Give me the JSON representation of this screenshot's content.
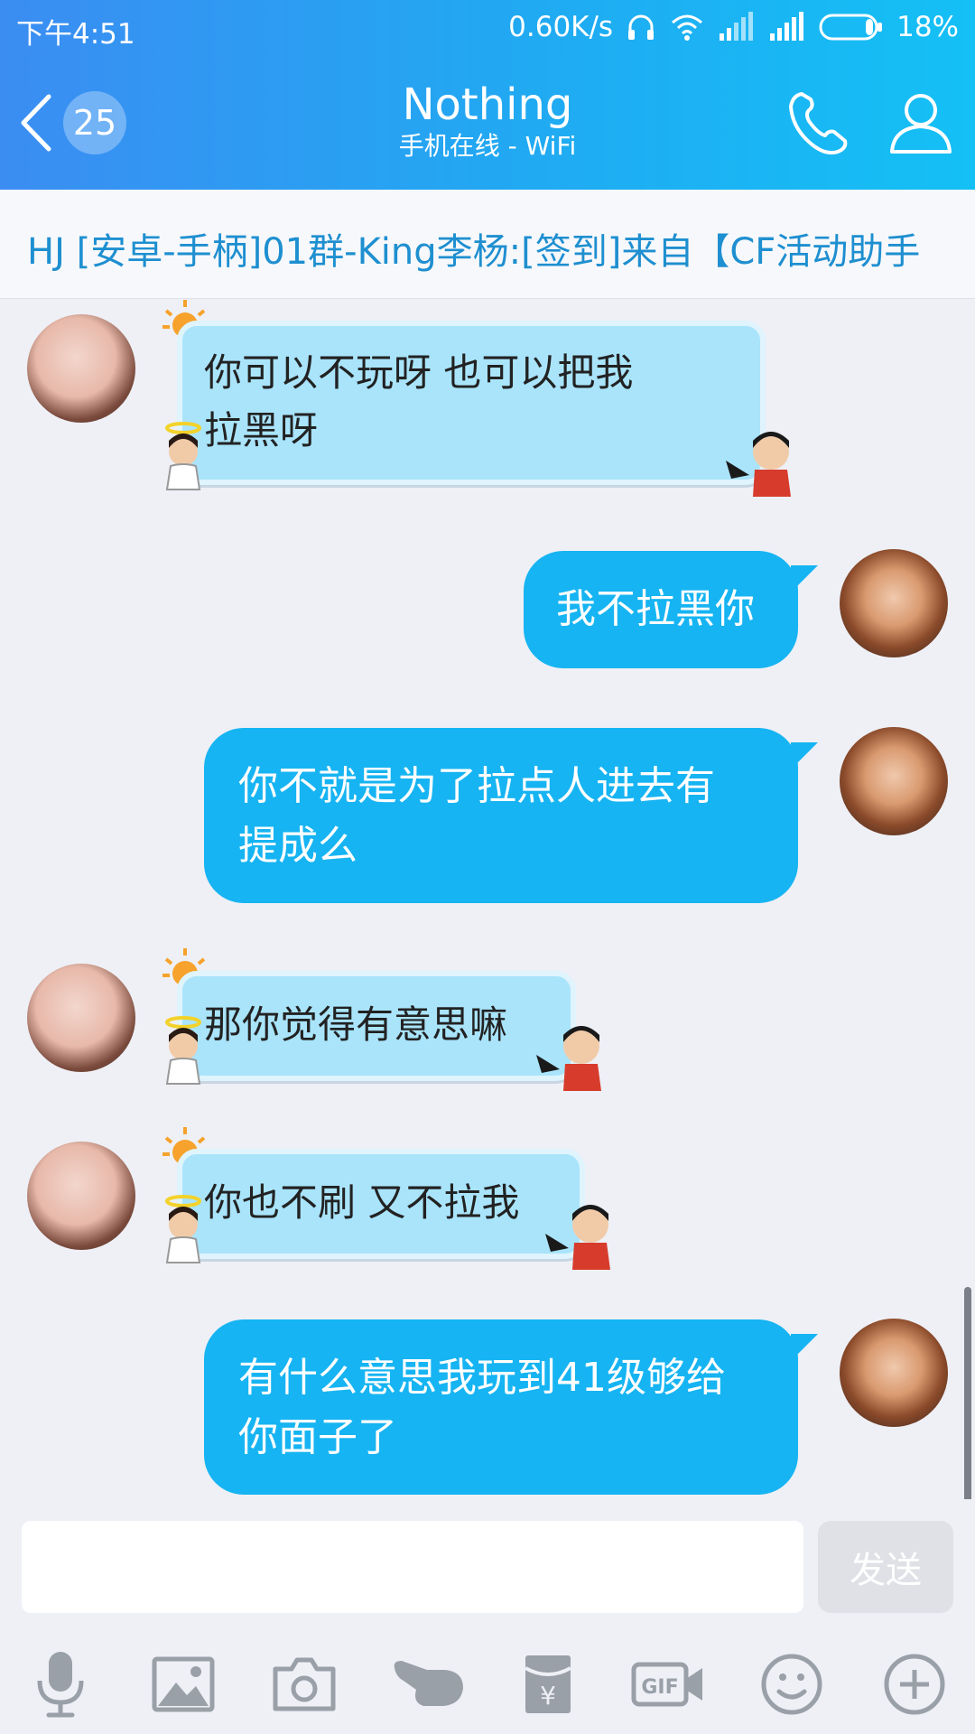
{
  "status_bar": {
    "time": "下午4:51",
    "network_speed": "0.60K/s",
    "battery": "18%"
  },
  "header": {
    "unread_count": "25",
    "title": "Nothing",
    "subtitle": "手机在线 - WiFi"
  },
  "notice": {
    "text": "HJ [安卓-手柄]01群-King李杨:[签到]来自【CF活动助手"
  },
  "messages": [
    {
      "from": "other",
      "text_lines": [
        " 你可以不玩呀  也可以把我",
        "拉黑呀"
      ]
    },
    {
      "from": "me",
      "text_lines": [
        "我不拉黑你"
      ]
    },
    {
      "from": "me",
      "text_lines": [
        "你不就是为了拉点人进去有",
        "提成么"
      ]
    },
    {
      "from": "other",
      "text_lines": [
        "那你觉得有意思嘛"
      ]
    },
    {
      "from": "other",
      "text_lines": [
        "你也不刷 又不拉我"
      ]
    },
    {
      "from": "me",
      "text_lines": [
        "有什么意思我玩到41级够给",
        "你面子了"
      ]
    }
  ],
  "input": {
    "placeholder": "",
    "send_label": "发送"
  },
  "toolbar": [
    "mic-icon",
    "image-icon",
    "camera-icon",
    "poke-icon",
    "red-packet-icon",
    "gif-icon",
    "emoji-icon",
    "plus-icon"
  ],
  "colors": {
    "header_start": "#3b8df2",
    "header_end": "#14c0f5",
    "my_bubble": "#16b4f2",
    "their_bubble": "#a9e4fb",
    "notice_text": "#1e8fd0"
  }
}
